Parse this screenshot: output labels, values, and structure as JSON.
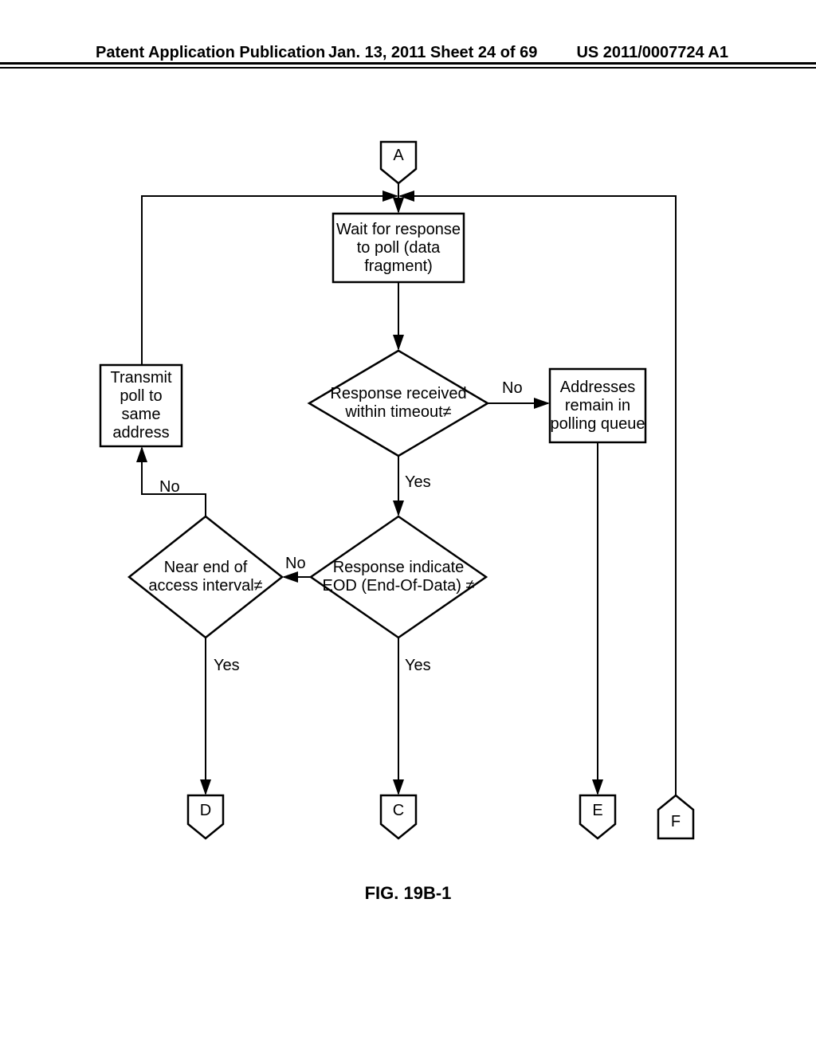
{
  "header": {
    "left": "Patent Application Publication",
    "center": "Jan. 13, 2011  Sheet 24 of 69",
    "right": "US 2011/0007724 A1"
  },
  "figure_caption": "FIG. 19B-1",
  "connectors": {
    "A": "A",
    "C": "C",
    "D": "D",
    "E": "E",
    "F": "F"
  },
  "boxes": {
    "wait": "Wait for response to poll (data fragment)",
    "transmit": "Transmit poll to same address",
    "addresses": "Addresses remain in polling queue"
  },
  "decisions": {
    "timeout": "Response received within timeout≠",
    "eod": "Response indicate EOD (End-Of-Data) ≠",
    "interval": "Near end of access interval≠"
  },
  "labels": {
    "no": "No",
    "yes": "Yes"
  }
}
